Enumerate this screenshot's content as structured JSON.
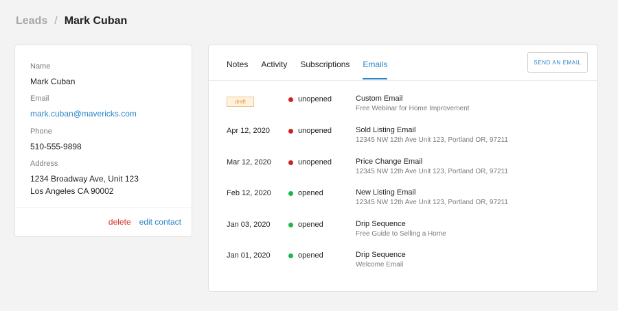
{
  "breadcrumb": {
    "root": "Leads",
    "separator": "/",
    "current": "Mark Cuban"
  },
  "contact": {
    "name_label": "Name",
    "name": "Mark Cuban",
    "email_label": "Email",
    "email": "mark.cuban@mavericks.com",
    "phone_label": "Phone",
    "phone": "510-555-9898",
    "address_label": "Address",
    "address_line1": "1234 Broadway Ave, Unit 123",
    "address_line2": "Los Angeles CA 90002",
    "delete_label": "delete",
    "edit_label": "edit contact"
  },
  "tabs": [
    {
      "label": "Notes",
      "active": false
    },
    {
      "label": "Activity",
      "active": false
    },
    {
      "label": "Subscriptions",
      "active": false
    },
    {
      "label": "Emails",
      "active": true
    }
  ],
  "send_button_label": "SEND AN EMAIL",
  "emails": [
    {
      "date": "",
      "badge": "draft",
      "status": "unopened",
      "status_color": "#d0211c",
      "title": "Custom Email",
      "subtitle": "Free Webinar for Home Improvement"
    },
    {
      "date": "Apr 12, 2020",
      "badge": "",
      "status": "unopened",
      "status_color": "#d0211c",
      "title": "Sold Listing Email",
      "subtitle": "12345 NW 12th Ave Unit 123, Portland OR, 97211"
    },
    {
      "date": "Mar 12, 2020",
      "badge": "",
      "status": "unopened",
      "status_color": "#d0211c",
      "title": "Price Change Email",
      "subtitle": "12345 NW 12th Ave Unit 123, Portland OR, 97211"
    },
    {
      "date": "Feb 12, 2020",
      "badge": "",
      "status": "opened",
      "status_color": "#1fb54a",
      "title": "New Listing Email",
      "subtitle": "12345 NW 12th Ave Unit 123, Portland OR, 97211"
    },
    {
      "date": "Jan 03, 2020",
      "badge": "",
      "status": "opened",
      "status_color": "#1fb54a",
      "title": "Drip Sequence",
      "subtitle": "Free Guide to Selling a Home"
    },
    {
      "date": "Jan 01, 2020",
      "badge": "",
      "status": "opened",
      "status_color": "#1fb54a",
      "title": "Drip Sequence",
      "subtitle": "Welcome Email"
    }
  ]
}
